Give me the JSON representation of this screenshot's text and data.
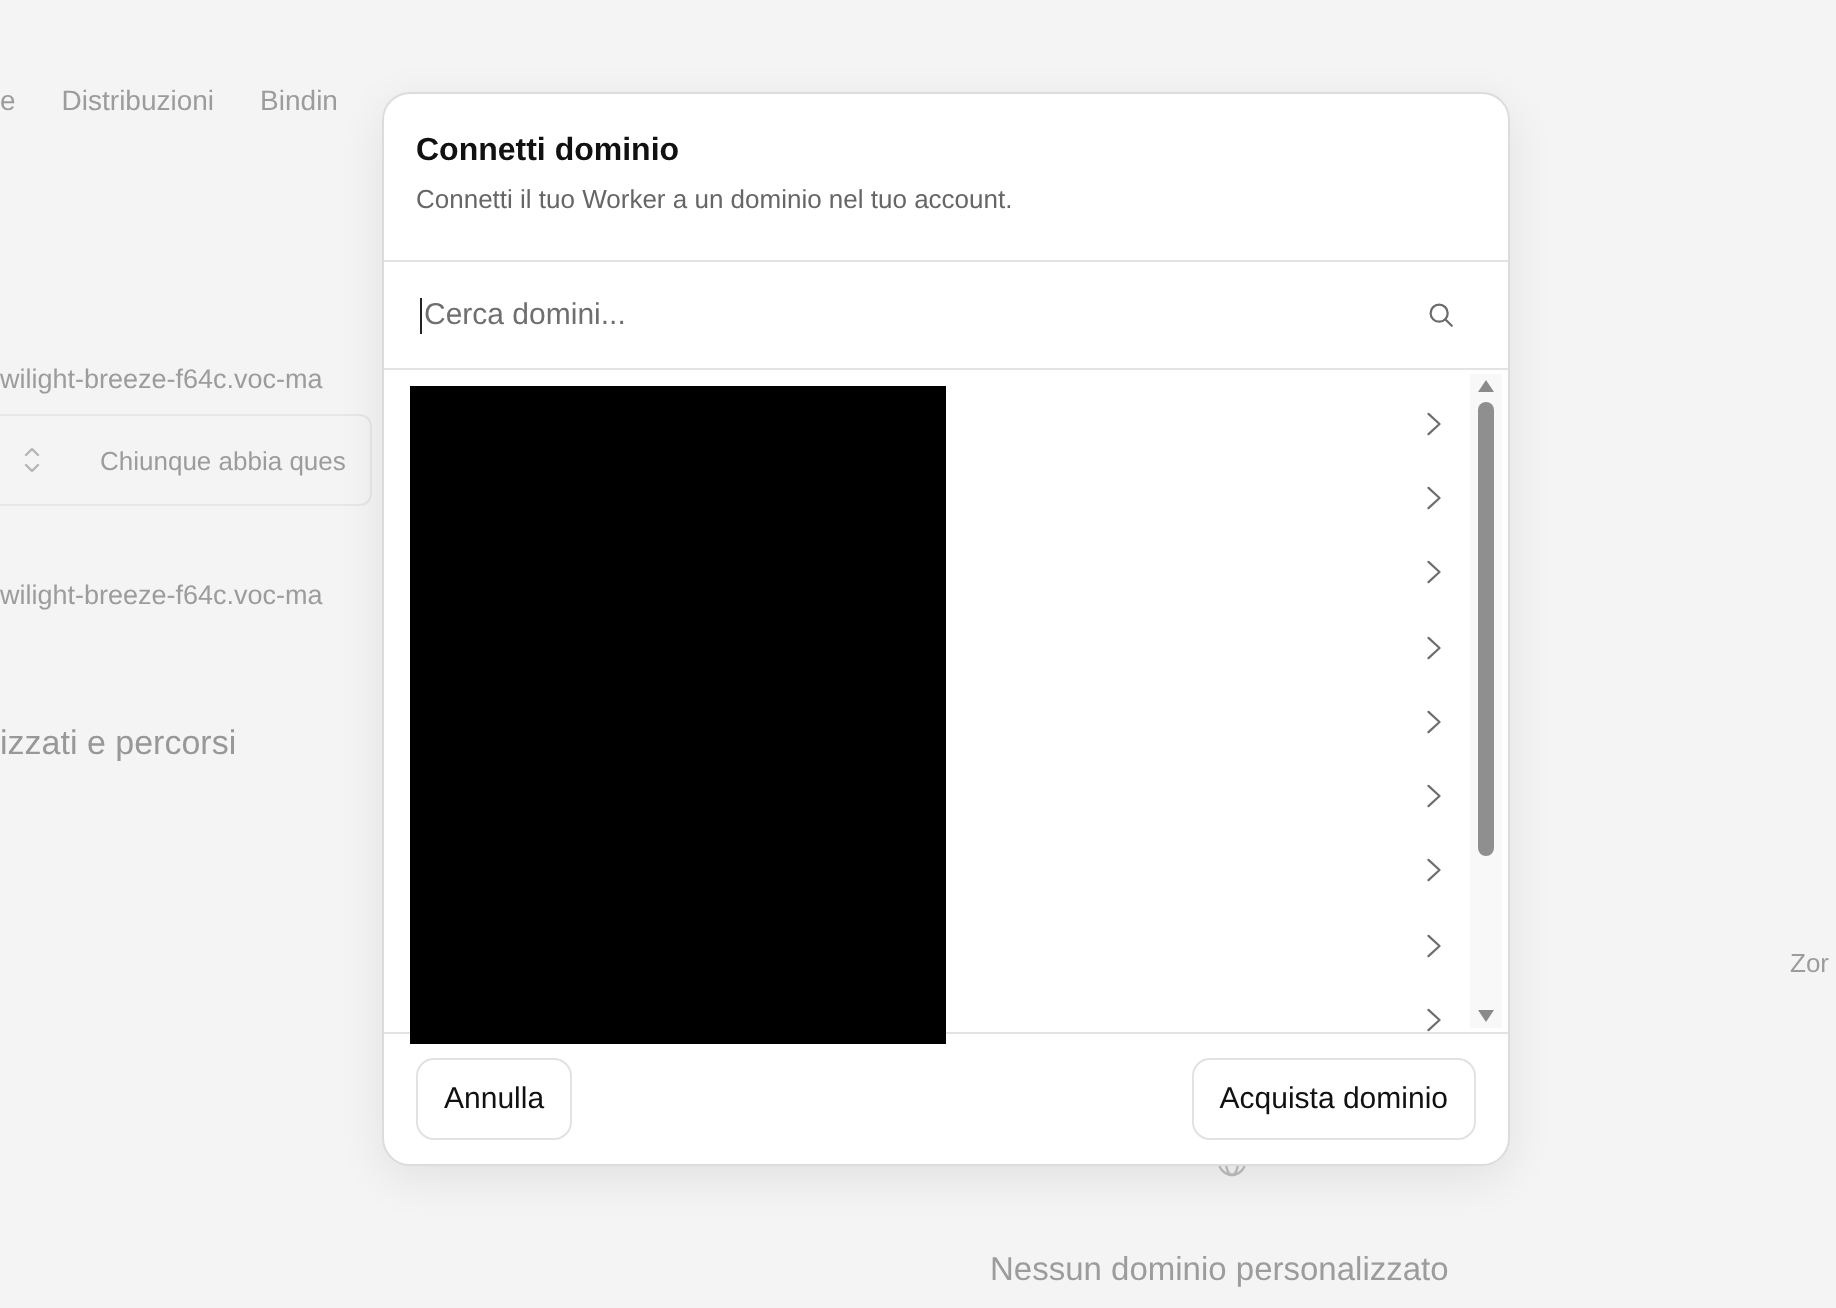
{
  "background_page": {
    "tabs": [
      {
        "label": "e"
      },
      {
        "label": "Distribuzioni"
      },
      {
        "label": "Bindin"
      }
    ],
    "hostname_1": "wilight-breeze-f64c.voc-ma",
    "access_select": {
      "value": "Chiunque abbia ques"
    },
    "hostname_2": "wilight-breeze-f64c.voc-ma",
    "section_heading": "izzati e percorsi",
    "column_label": "Zor",
    "empty_state": "Nessun dominio personalizzato"
  },
  "dialog": {
    "title": "Connetti dominio",
    "subtitle": "Connetti il tuo Worker a un dominio nel tuo account.",
    "search": {
      "placeholder": "Cerca domini...",
      "focused": true
    },
    "domain_list": {
      "redacted": true,
      "rows": [
        {
          "kind": "link"
        },
        {
          "kind": "link"
        },
        {
          "kind": "link"
        },
        {
          "kind": "link"
        },
        {
          "kind": "link"
        },
        {
          "kind": "link"
        },
        {
          "kind": "link"
        },
        {
          "kind": "link"
        },
        {
          "kind": "link"
        }
      ]
    },
    "buttons": [
      {
        "label": "Annulla"
      },
      {
        "label": "Acquista dominio"
      }
    ]
  }
}
